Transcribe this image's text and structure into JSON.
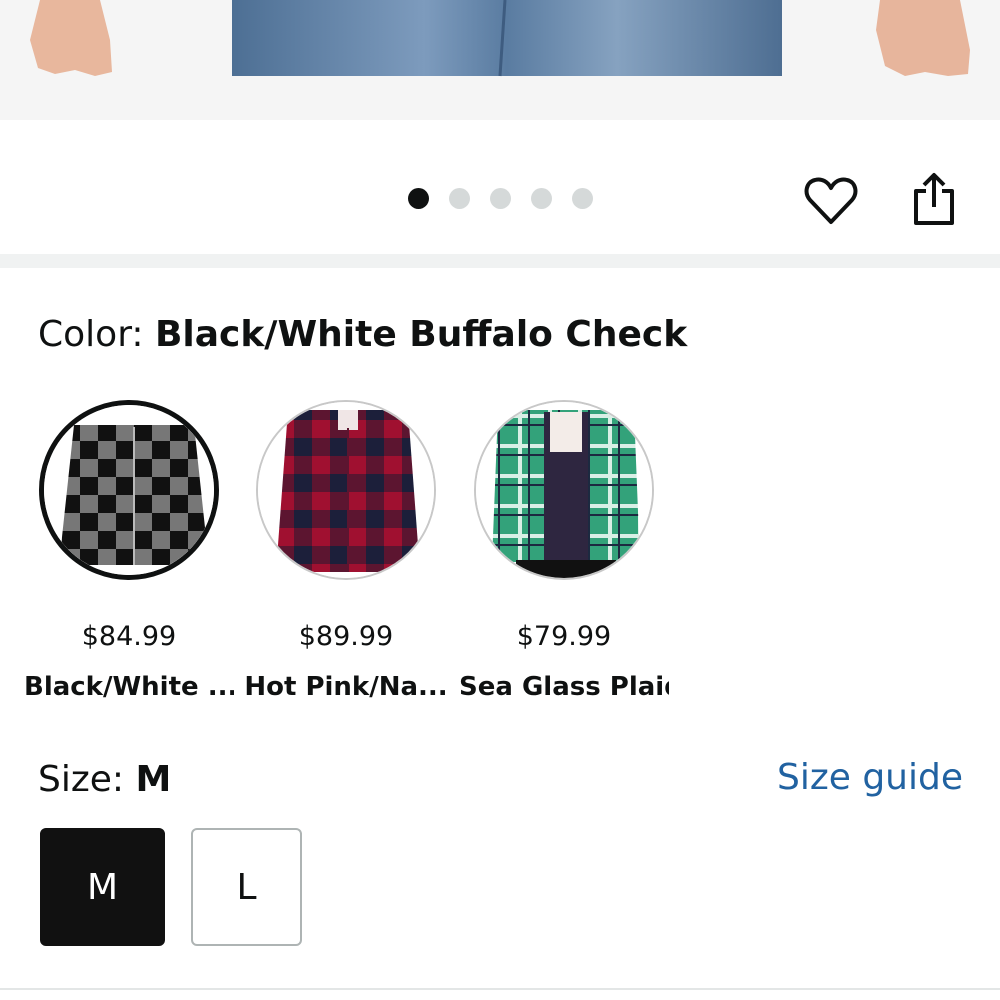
{
  "carousel": {
    "image_count": 5,
    "active_index": 0
  },
  "color": {
    "label": "Color:",
    "selected_value": "Black/White Buffalo Check",
    "swatches": [
      {
        "price": "$84.99",
        "name": "Black/White ...",
        "selected": true,
        "colors": [
          "#111111",
          "#f4f4f4"
        ]
      },
      {
        "price": "$89.99",
        "name": "Hot Pink/Na...",
        "selected": false,
        "colors": [
          "#c8143a",
          "#1c1f3a"
        ]
      },
      {
        "price": "$79.99",
        "name": "Sea Glass Plaid",
        "selected": false,
        "colors": [
          "#33a27a",
          "#d9efe6"
        ]
      }
    ]
  },
  "size": {
    "label": "Size:",
    "selected_value": "M",
    "guide_label": "Size guide",
    "options": [
      "M",
      "L"
    ]
  },
  "colors": {
    "link": "#2162a1",
    "selected_bg": "#111111",
    "dot_inactive": "#d5d9d9",
    "divider": "#f0f2f2"
  }
}
